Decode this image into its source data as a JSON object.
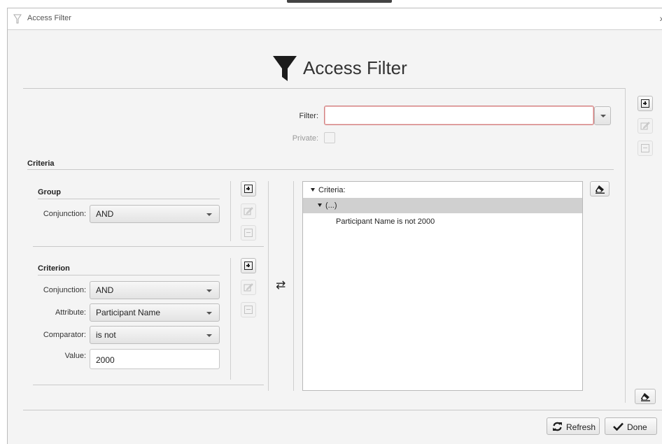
{
  "window": {
    "title": "Access Filter",
    "heading": "Access Filter"
  },
  "filter": {
    "label": "Filter:",
    "value": "",
    "private_label": "Private:"
  },
  "criteria_section": {
    "title": "Criteria"
  },
  "group": {
    "title": "Group",
    "conjunction_label": "Conjunction:",
    "conjunction_value": "AND"
  },
  "criterion": {
    "title": "Criterion",
    "conjunction_label": "Conjunction:",
    "conjunction_value": "AND",
    "attribute_label": "Attribute:",
    "attribute_value": "Participant Name",
    "comparator_label": "Comparator:",
    "comparator_value": "is not",
    "value_label": "Value:",
    "value": "2000"
  },
  "transfer_icon": "⇄",
  "tree": {
    "root": "Criteria:",
    "group_node": "(...)",
    "leaf": "Participant Name is not 2000"
  },
  "footer": {
    "refresh_label": "Refresh",
    "done_label": "Done"
  },
  "icons": {
    "add": "plus-square-icon",
    "edit": "edit-icon",
    "remove": "minus-square-icon",
    "clear": "eraser-icon",
    "filter": "funnel-icon"
  },
  "colors": {
    "focus_border": "#d08080",
    "selected_row": "#d0d0d0"
  }
}
